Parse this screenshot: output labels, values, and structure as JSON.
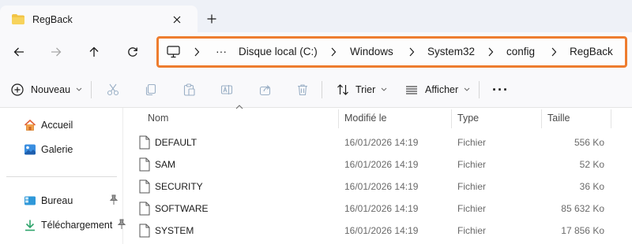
{
  "tab": {
    "title": "RegBack"
  },
  "address": {
    "crumbs": [
      "Disque local (C:)",
      "Windows",
      "System32",
      "config",
      "RegBack"
    ],
    "overflow": "···"
  },
  "commands": {
    "new_label": "Nouveau",
    "sort_label": "Trier",
    "view_label": "Afficher",
    "more": "···"
  },
  "sidebar": {
    "items": [
      {
        "label": "Accueil",
        "icon": "home-icon"
      },
      {
        "label": "Galerie",
        "icon": "gallery-icon"
      },
      {
        "label": "Bureau",
        "icon": "desktop-icon",
        "pinned": true
      },
      {
        "label": "Téléchargement",
        "icon": "download-icon",
        "pinned": true
      }
    ]
  },
  "columns": {
    "name": "Nom",
    "modified": "Modifié le",
    "type": "Type",
    "size": "Taille"
  },
  "files": [
    {
      "name": "DEFAULT",
      "modified": "16/01/2026 14:19",
      "type": "Fichier",
      "size": "556 Ko"
    },
    {
      "name": "SAM",
      "modified": "16/01/2026 14:19",
      "type": "Fichier",
      "size": "52 Ko"
    },
    {
      "name": "SECURITY",
      "modified": "16/01/2026 14:19",
      "type": "Fichier",
      "size": "36 Ko"
    },
    {
      "name": "SOFTWARE",
      "modified": "16/01/2026 14:19",
      "type": "Fichier",
      "size": "85 632 Ko"
    },
    {
      "name": "SYSTEM",
      "modified": "16/01/2026 14:19",
      "type": "Fichier",
      "size": "17 856 Ko"
    }
  ],
  "colors": {
    "accent": "#ee7d2f",
    "folder": "#f2c446",
    "tab_bg": "#eef1f7",
    "disabled_icon": "#9bb0c6"
  }
}
